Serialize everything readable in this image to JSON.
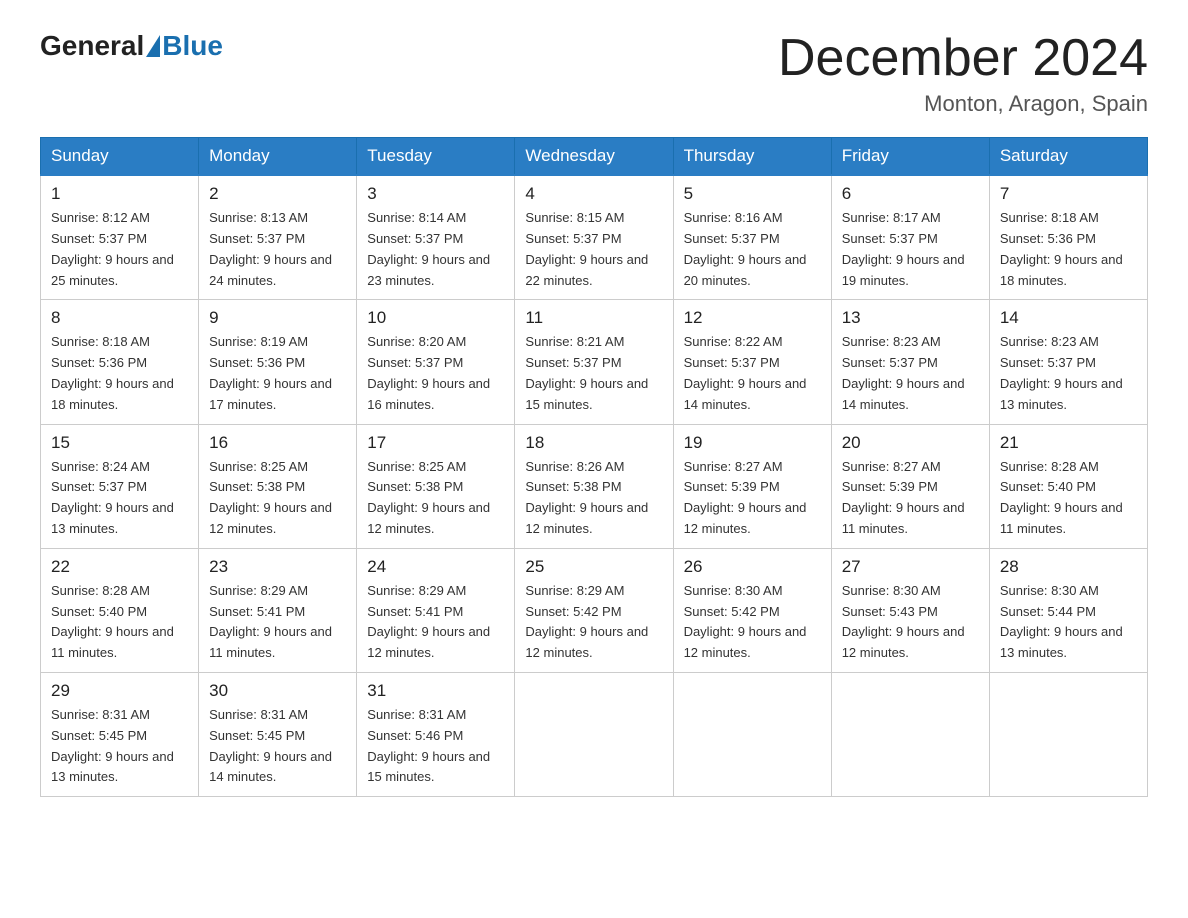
{
  "logo": {
    "general": "General",
    "blue": "Blue"
  },
  "header": {
    "month": "December 2024",
    "location": "Monton, Aragon, Spain"
  },
  "days_of_week": [
    "Sunday",
    "Monday",
    "Tuesday",
    "Wednesday",
    "Thursday",
    "Friday",
    "Saturday"
  ],
  "weeks": [
    [
      {
        "date": "1",
        "sunrise": "8:12 AM",
        "sunset": "5:37 PM",
        "daylight": "9 hours and 25 minutes."
      },
      {
        "date": "2",
        "sunrise": "8:13 AM",
        "sunset": "5:37 PM",
        "daylight": "9 hours and 24 minutes."
      },
      {
        "date": "3",
        "sunrise": "8:14 AM",
        "sunset": "5:37 PM",
        "daylight": "9 hours and 23 minutes."
      },
      {
        "date": "4",
        "sunrise": "8:15 AM",
        "sunset": "5:37 PM",
        "daylight": "9 hours and 22 minutes."
      },
      {
        "date": "5",
        "sunrise": "8:16 AM",
        "sunset": "5:37 PM",
        "daylight": "9 hours and 20 minutes."
      },
      {
        "date": "6",
        "sunrise": "8:17 AM",
        "sunset": "5:37 PM",
        "daylight": "9 hours and 19 minutes."
      },
      {
        "date": "7",
        "sunrise": "8:18 AM",
        "sunset": "5:36 PM",
        "daylight": "9 hours and 18 minutes."
      }
    ],
    [
      {
        "date": "8",
        "sunrise": "8:18 AM",
        "sunset": "5:36 PM",
        "daylight": "9 hours and 18 minutes."
      },
      {
        "date": "9",
        "sunrise": "8:19 AM",
        "sunset": "5:36 PM",
        "daylight": "9 hours and 17 minutes."
      },
      {
        "date": "10",
        "sunrise": "8:20 AM",
        "sunset": "5:37 PM",
        "daylight": "9 hours and 16 minutes."
      },
      {
        "date": "11",
        "sunrise": "8:21 AM",
        "sunset": "5:37 PM",
        "daylight": "9 hours and 15 minutes."
      },
      {
        "date": "12",
        "sunrise": "8:22 AM",
        "sunset": "5:37 PM",
        "daylight": "9 hours and 14 minutes."
      },
      {
        "date": "13",
        "sunrise": "8:23 AM",
        "sunset": "5:37 PM",
        "daylight": "9 hours and 14 minutes."
      },
      {
        "date": "14",
        "sunrise": "8:23 AM",
        "sunset": "5:37 PM",
        "daylight": "9 hours and 13 minutes."
      }
    ],
    [
      {
        "date": "15",
        "sunrise": "8:24 AM",
        "sunset": "5:37 PM",
        "daylight": "9 hours and 13 minutes."
      },
      {
        "date": "16",
        "sunrise": "8:25 AM",
        "sunset": "5:38 PM",
        "daylight": "9 hours and 12 minutes."
      },
      {
        "date": "17",
        "sunrise": "8:25 AM",
        "sunset": "5:38 PM",
        "daylight": "9 hours and 12 minutes."
      },
      {
        "date": "18",
        "sunrise": "8:26 AM",
        "sunset": "5:38 PM",
        "daylight": "9 hours and 12 minutes."
      },
      {
        "date": "19",
        "sunrise": "8:27 AM",
        "sunset": "5:39 PM",
        "daylight": "9 hours and 12 minutes."
      },
      {
        "date": "20",
        "sunrise": "8:27 AM",
        "sunset": "5:39 PM",
        "daylight": "9 hours and 11 minutes."
      },
      {
        "date": "21",
        "sunrise": "8:28 AM",
        "sunset": "5:40 PM",
        "daylight": "9 hours and 11 minutes."
      }
    ],
    [
      {
        "date": "22",
        "sunrise": "8:28 AM",
        "sunset": "5:40 PM",
        "daylight": "9 hours and 11 minutes."
      },
      {
        "date": "23",
        "sunrise": "8:29 AM",
        "sunset": "5:41 PM",
        "daylight": "9 hours and 11 minutes."
      },
      {
        "date": "24",
        "sunrise": "8:29 AM",
        "sunset": "5:41 PM",
        "daylight": "9 hours and 12 minutes."
      },
      {
        "date": "25",
        "sunrise": "8:29 AM",
        "sunset": "5:42 PM",
        "daylight": "9 hours and 12 minutes."
      },
      {
        "date": "26",
        "sunrise": "8:30 AM",
        "sunset": "5:42 PM",
        "daylight": "9 hours and 12 minutes."
      },
      {
        "date": "27",
        "sunrise": "8:30 AM",
        "sunset": "5:43 PM",
        "daylight": "9 hours and 12 minutes."
      },
      {
        "date": "28",
        "sunrise": "8:30 AM",
        "sunset": "5:44 PM",
        "daylight": "9 hours and 13 minutes."
      }
    ],
    [
      {
        "date": "29",
        "sunrise": "8:31 AM",
        "sunset": "5:45 PM",
        "daylight": "9 hours and 13 minutes."
      },
      {
        "date": "30",
        "sunrise": "8:31 AM",
        "sunset": "5:45 PM",
        "daylight": "9 hours and 14 minutes."
      },
      {
        "date": "31",
        "sunrise": "8:31 AM",
        "sunset": "5:46 PM",
        "daylight": "9 hours and 15 minutes."
      },
      null,
      null,
      null,
      null
    ]
  ]
}
